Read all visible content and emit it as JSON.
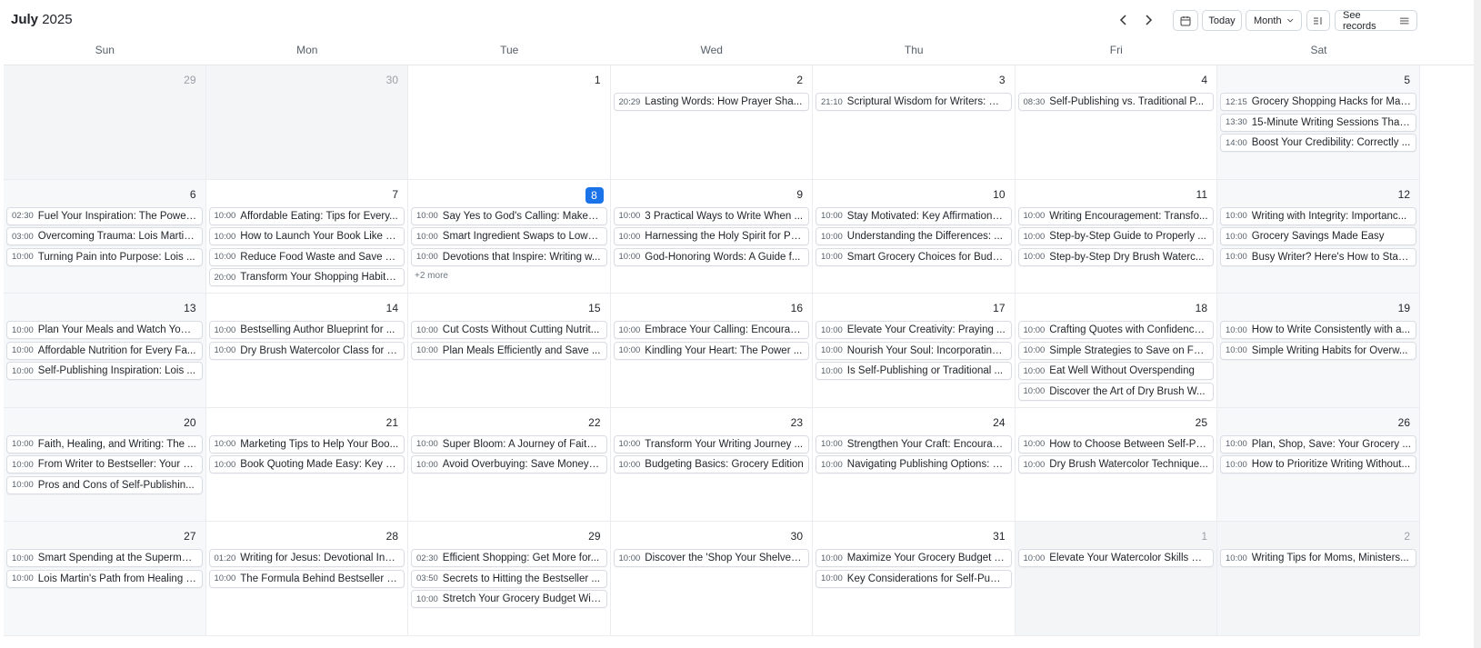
{
  "header": {
    "month": "July",
    "year": "2025",
    "today_label": "Today",
    "view_label": "Month",
    "see_records_label": "See records",
    "icons": {
      "prev": "chevron-left-icon",
      "next": "chevron-right-icon",
      "calendar": "calendar-icon",
      "view_dropdown": "chevron-down-icon",
      "layout": "list-view-icon",
      "records": "menu-icon"
    }
  },
  "weekdays": [
    "Sun",
    "Mon",
    "Tue",
    "Wed",
    "Thu",
    "Fri",
    "Sat"
  ],
  "colors": {
    "today": "#1a73e8",
    "weekend_bg": "#f7f8fa",
    "border": "#d9dde3"
  },
  "weeks": [
    [
      {
        "day": "29",
        "muted": true,
        "events": []
      },
      {
        "day": "30",
        "muted": true,
        "events": []
      },
      {
        "day": "1",
        "events": []
      },
      {
        "day": "2",
        "events": [
          {
            "time": "20:29",
            "title": "Lasting Words: How Prayer Sha..."
          }
        ]
      },
      {
        "day": "3",
        "events": [
          {
            "time": "21:10",
            "title": "Scriptural Wisdom for Writers: Bi..."
          }
        ]
      },
      {
        "day": "4",
        "events": [
          {
            "time": "08:30",
            "title": "Self-Publishing vs. Traditional P..."
          }
        ]
      },
      {
        "day": "5",
        "events": [
          {
            "time": "12:15",
            "title": "Grocery Shopping Hacks for Max..."
          },
          {
            "time": "13:30",
            "title": "15-Minute Writing Sessions That..."
          },
          {
            "time": "14:00",
            "title": "Boost Your Credibility: Correctly ..."
          }
        ]
      }
    ],
    [
      {
        "day": "6",
        "events": [
          {
            "time": "02:30",
            "title": "Fuel Your Inspiration: The Power..."
          },
          {
            "time": "03:00",
            "title": "Overcoming Trauma: Lois Martin..."
          },
          {
            "time": "10:00",
            "title": "Turning Pain into Purpose: Lois ..."
          }
        ]
      },
      {
        "day": "7",
        "events": [
          {
            "time": "10:00",
            "title": "Affordable Eating: Tips for Every..."
          },
          {
            "time": "10:00",
            "title": "How to Launch Your Book Like a ..."
          },
          {
            "time": "10:00",
            "title": "Reduce Food Waste and Save M..."
          },
          {
            "time": "20:00",
            "title": "Transform Your Shopping Habits..."
          }
        ]
      },
      {
        "day": "8",
        "today": true,
        "more": "+2 more",
        "events": [
          {
            "time": "10:00",
            "title": "Say Yes to God's Calling: Make a..."
          },
          {
            "time": "10:00",
            "title": "Smart Ingredient Swaps to Lowe..."
          },
          {
            "time": "10:00",
            "title": "Devotions that Inspire: Writing w..."
          }
        ]
      },
      {
        "day": "9",
        "events": [
          {
            "time": "10:00",
            "title": "3 Practical Ways to Write When ..."
          },
          {
            "time": "10:00",
            "title": "Harnessing the Holy Spirit for Po..."
          },
          {
            "time": "10:00",
            "title": "God-Honoring Words: A Guide f..."
          }
        ]
      },
      {
        "day": "10",
        "events": [
          {
            "time": "10:00",
            "title": "Stay Motivated: Key Affirmations..."
          },
          {
            "time": "10:00",
            "title": "Understanding the Differences: ..."
          },
          {
            "time": "10:00",
            "title": "Smart Grocery Choices for Budg..."
          }
        ]
      },
      {
        "day": "11",
        "events": [
          {
            "time": "10:00",
            "title": "Writing Encouragement: Transfo..."
          },
          {
            "time": "10:00",
            "title": "Step-by-Step Guide to Properly ..."
          },
          {
            "time": "10:00",
            "title": "Step-by-Step Dry Brush Waterc..."
          }
        ]
      },
      {
        "day": "12",
        "events": [
          {
            "time": "10:00",
            "title": "Writing with Integrity: Importanc..."
          },
          {
            "time": "10:00",
            "title": "Grocery Savings Made Easy"
          },
          {
            "time": "10:00",
            "title": "Busy Writer? Here's How to Stay..."
          }
        ]
      }
    ],
    [
      {
        "day": "13",
        "events": [
          {
            "time": "10:00",
            "title": "Plan Your Meals and Watch Your ..."
          },
          {
            "time": "10:00",
            "title": "Affordable Nutrition for Every Fa..."
          },
          {
            "time": "10:00",
            "title": "Self-Publishing Inspiration: Lois ..."
          }
        ]
      },
      {
        "day": "14",
        "events": [
          {
            "time": "10:00",
            "title": "Bestselling Author Blueprint for ..."
          },
          {
            "time": "10:00",
            "title": "Dry Brush Watercolor Class for B..."
          }
        ]
      },
      {
        "day": "15",
        "events": [
          {
            "time": "10:00",
            "title": "Cut Costs Without Cutting Nutrit..."
          },
          {
            "time": "10:00",
            "title": "Plan Meals Efficiently and Save ..."
          }
        ]
      },
      {
        "day": "16",
        "events": [
          {
            "time": "10:00",
            "title": "Embrace Your Calling: Encourag..."
          },
          {
            "time": "10:00",
            "title": "Kindling Your Heart: The Power ..."
          }
        ]
      },
      {
        "day": "17",
        "events": [
          {
            "time": "10:00",
            "title": "Elevate Your Creativity: Praying ..."
          },
          {
            "time": "10:00",
            "title": "Nourish Your Soul: Incorporating..."
          },
          {
            "time": "10:00",
            "title": "Is Self-Publishing or Traditional ..."
          }
        ]
      },
      {
        "day": "18",
        "events": [
          {
            "time": "10:00",
            "title": "Crafting Quotes with Confidence..."
          },
          {
            "time": "10:00",
            "title": "Simple Strategies to Save on Food"
          },
          {
            "time": "10:00",
            "title": "Eat Well Without Overspending"
          },
          {
            "time": "10:00",
            "title": "Discover the Art of Dry Brush W..."
          }
        ]
      },
      {
        "day": "19",
        "events": [
          {
            "time": "10:00",
            "title": "How to Write Consistently with a..."
          },
          {
            "time": "10:00",
            "title": "Simple Writing Habits for Overw..."
          }
        ]
      }
    ],
    [
      {
        "day": "20",
        "events": [
          {
            "time": "10:00",
            "title": "Faith, Healing, and Writing: The ..."
          },
          {
            "time": "10:00",
            "title": "From Writer to Bestseller: Your R..."
          },
          {
            "time": "10:00",
            "title": "Pros and Cons of Self-Publishin..."
          }
        ]
      },
      {
        "day": "21",
        "events": [
          {
            "time": "10:00",
            "title": "Marketing Tips to Help Your Boo..."
          },
          {
            "time": "10:00",
            "title": "Book Quoting Made Easy: Key St..."
          }
        ]
      },
      {
        "day": "22",
        "events": [
          {
            "time": "10:00",
            "title": "Super Bloom: A Journey of Faith ..."
          },
          {
            "time": "10:00",
            "title": "Avoid Overbuying: Save Money o..."
          }
        ]
      },
      {
        "day": "23",
        "events": [
          {
            "time": "10:00",
            "title": "Transform Your Writing Journey ..."
          },
          {
            "time": "10:00",
            "title": "Budgeting Basics: Grocery Edition"
          }
        ]
      },
      {
        "day": "24",
        "events": [
          {
            "time": "10:00",
            "title": "Strengthen Your Craft: Encourag..."
          },
          {
            "time": "10:00",
            "title": "Navigating Publishing Options: S..."
          }
        ]
      },
      {
        "day": "25",
        "events": [
          {
            "time": "10:00",
            "title": "How to Choose Between Self-Pu..."
          },
          {
            "time": "10:00",
            "title": "Dry Brush Watercolor Technique..."
          }
        ]
      },
      {
        "day": "26",
        "events": [
          {
            "time": "10:00",
            "title": "Plan, Shop, Save: Your Grocery ..."
          },
          {
            "time": "10:00",
            "title": "How to Prioritize Writing Without..."
          }
        ]
      }
    ],
    [
      {
        "day": "27",
        "events": [
          {
            "time": "10:00",
            "title": "Smart Spending at the Supermar..."
          },
          {
            "time": "10:00",
            "title": "Lois Martin's Path from Healing t..."
          }
        ]
      },
      {
        "day": "28",
        "events": [
          {
            "time": "01:20",
            "title": "Writing for Jesus: Devotional Insi..."
          },
          {
            "time": "10:00",
            "title": "The Formula Behind Bestseller B..."
          }
        ]
      },
      {
        "day": "29",
        "events": [
          {
            "time": "02:30",
            "title": "Efficient Shopping: Get More for..."
          },
          {
            "time": "03:50",
            "title": "Secrets to Hitting the Bestseller ..."
          },
          {
            "time": "10:00",
            "title": "Stretch Your Grocery Budget Wit..."
          }
        ]
      },
      {
        "day": "30",
        "events": [
          {
            "time": "10:00",
            "title": "Discover the 'Shop Your Shelves..."
          }
        ]
      },
      {
        "day": "31",
        "events": [
          {
            "time": "10:00",
            "title": "Maximize Your Grocery Budget T..."
          },
          {
            "time": "10:00",
            "title": "Key Considerations for Self-Publ..."
          }
        ]
      },
      {
        "day": "1",
        "muted": true,
        "events": [
          {
            "time": "10:00",
            "title": "Elevate Your Watercolor Skills wi..."
          }
        ]
      },
      {
        "day": "2",
        "muted": true,
        "events": [
          {
            "time": "10:00",
            "title": "Writing Tips for Moms, Ministers..."
          }
        ]
      }
    ]
  ]
}
